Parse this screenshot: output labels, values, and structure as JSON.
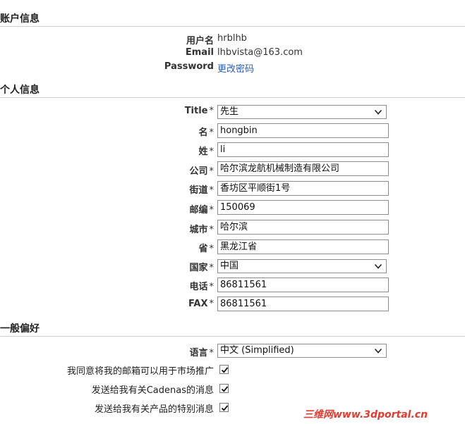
{
  "account": {
    "title": "账户信息",
    "username_label": "用户名",
    "username": "hrblhb",
    "email_label": "Email",
    "email": "lhbvista@163.com",
    "password_label": "Password",
    "password_link": "更改密码"
  },
  "personal": {
    "title": "个人信息",
    "required_mark": "*",
    "title_label": "Title",
    "title_value": "先生",
    "first_label": "名",
    "first_value": "hongbin",
    "last_label": "姓",
    "last_value": "li",
    "company_label": "公司",
    "company_value": "哈尔滨龙航机械制造有限公司",
    "street_label": "街道",
    "street_value": "香坊区平顺街1号",
    "zip_label": "邮编",
    "zip_value": "150069",
    "city_label": "城市",
    "city_value": "哈尔滨",
    "province_label": "省",
    "province_value": "黑龙江省",
    "country_label": "国家",
    "country_value": "中国",
    "phone_label": "电话",
    "phone_value": "86811561",
    "fax_label": "FAX",
    "fax_value": "86811561"
  },
  "prefs": {
    "title": "一般偏好",
    "language_label": "语言",
    "language_value": "中文 (Simplified)",
    "marketing_label": "我同意将我的邮箱可以用于市场推广",
    "marketing_checked": true,
    "cadenas_label": "发送给我有关Cadenas的消息",
    "cadenas_checked": true,
    "products_label": "发送给我有关产品的特别消息",
    "products_checked": true
  },
  "watermark": "三维网www.3dportal.cn",
  "colors": {
    "link": "#2a5db0",
    "watermark": "#e33b2f",
    "divider": "#cfcfcf"
  }
}
